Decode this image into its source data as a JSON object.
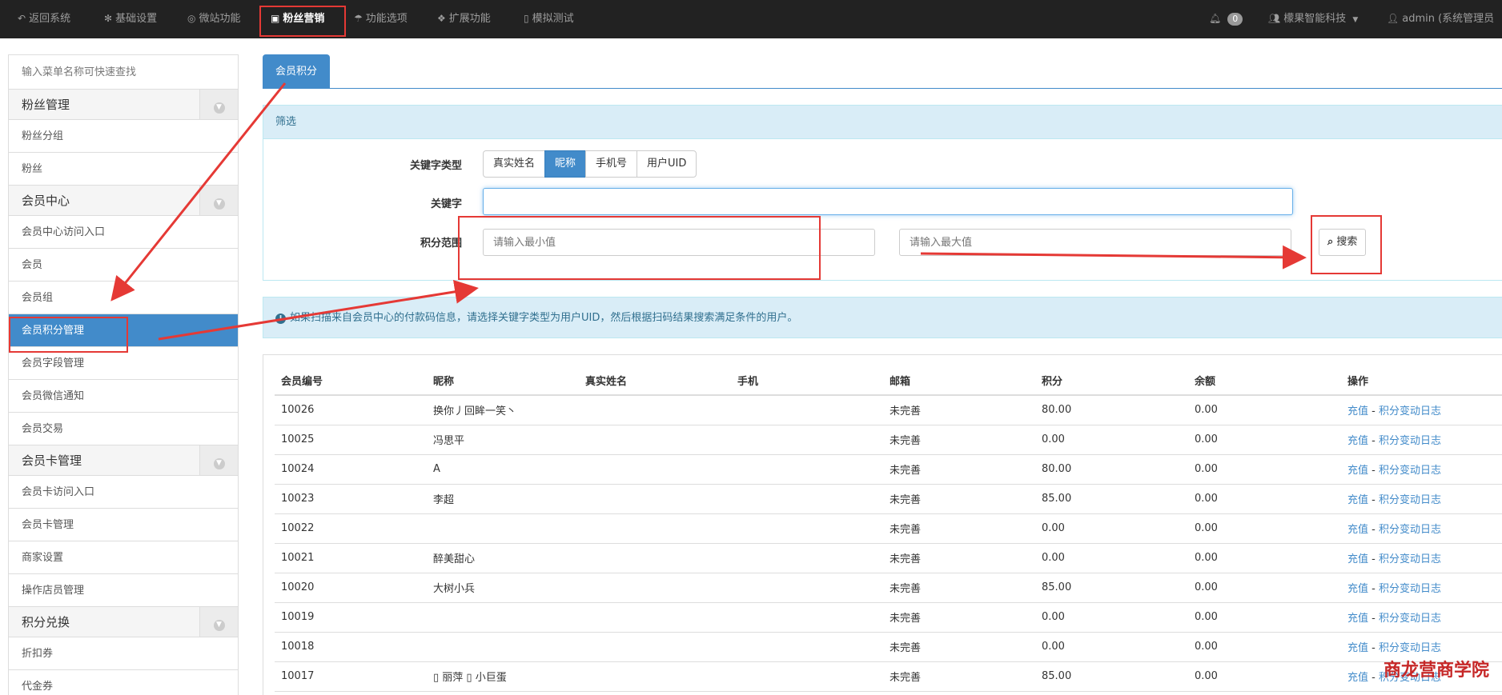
{
  "topnav": {
    "items": [
      {
        "icon": "undo-icon",
        "glyph": "↶",
        "label": "返回系统"
      },
      {
        "icon": "gear-icon",
        "glyph": "✻",
        "label": "基础设置"
      },
      {
        "icon": "globe-icon",
        "glyph": "◎",
        "label": "微站功能"
      },
      {
        "icon": "gift-icon",
        "glyph": "▣",
        "label": "粉丝营销"
      },
      {
        "icon": "umbrella-icon",
        "glyph": "☂",
        "label": "功能选项"
      },
      {
        "icon": "cubes-icon",
        "glyph": "❖",
        "label": "扩展功能"
      },
      {
        "icon": "mobile-icon",
        "glyph": "▯",
        "label": "模拟测试"
      }
    ],
    "notifications": "0",
    "company": "檬果智能科技",
    "user": "admin (系统管理员"
  },
  "sidebar": {
    "search_placeholder": "输入菜单名称可快速查找",
    "sections": [
      {
        "title": "粉丝管理",
        "items": [
          "粉丝分组",
          "粉丝"
        ]
      },
      {
        "title": "会员中心",
        "items": [
          "会员中心访问入口",
          "会员",
          "会员组",
          "会员积分管理",
          "会员字段管理",
          "会员微信通知",
          "会员交易"
        ]
      },
      {
        "title": "会员卡管理",
        "items": [
          "会员卡访问入口",
          "会员卡管理",
          "商家设置",
          "操作店员管理"
        ]
      },
      {
        "title": "积分兑换",
        "items": [
          "折扣券",
          "代金券"
        ]
      }
    ]
  },
  "main": {
    "tab": "会员积分",
    "filter": {
      "title": "筛选",
      "keyword_type_label": "关键字类型",
      "keyword_types": [
        "真实姓名",
        "昵称",
        "手机号",
        "用户UID"
      ],
      "keyword_label": "关键字",
      "keyword_value": "",
      "range_label": "积分范围",
      "min_placeholder": "请输入最小值",
      "max_placeholder": "请输入最大值",
      "search_label": "搜索"
    },
    "info": "如果扫描来自会员中心的付款码信息，请选择关键字类型为用户UID，然后根据扫码结果搜索满足条件的用户。",
    "table": {
      "headers": [
        "会员编号",
        "昵称",
        "真实姓名",
        "手机",
        "邮箱",
        "积分",
        "余额",
        "操作"
      ],
      "recharge_label": "充值",
      "separator": " - ",
      "log_label": "积分变动日志",
      "rows": [
        {
          "id": "10026",
          "nickname": "换你丿回眸一笑丶",
          "realname": "",
          "phone": "",
          "email": "未完善",
          "points": "80.00",
          "balance": "0.00"
        },
        {
          "id": "10025",
          "nickname": "冯思平",
          "realname": "",
          "phone": "",
          "email": "未完善",
          "points": "0.00",
          "balance": "0.00"
        },
        {
          "id": "10024",
          "nickname": "A",
          "realname": "",
          "phone": "",
          "email": "未完善",
          "points": "80.00",
          "balance": "0.00"
        },
        {
          "id": "10023",
          "nickname": "李超",
          "realname": "",
          "phone": "",
          "email": "未完善",
          "points": "85.00",
          "balance": "0.00"
        },
        {
          "id": "10022",
          "nickname": "",
          "realname": "",
          "phone": "",
          "email": "未完善",
          "points": "0.00",
          "balance": "0.00"
        },
        {
          "id": "10021",
          "nickname": "醉美甜心",
          "realname": "",
          "phone": "",
          "email": "未完善",
          "points": "0.00",
          "balance": "0.00"
        },
        {
          "id": "10020",
          "nickname": "大树小兵",
          "realname": "",
          "phone": "",
          "email": "未完善",
          "points": "85.00",
          "balance": "0.00"
        },
        {
          "id": "10019",
          "nickname": "",
          "realname": "",
          "phone": "",
          "email": "未完善",
          "points": "0.00",
          "balance": "0.00"
        },
        {
          "id": "10018",
          "nickname": "",
          "realname": "",
          "phone": "",
          "email": "未完善",
          "points": "0.00",
          "balance": "0.00"
        },
        {
          "id": "10017",
          "nickname": "▯ 丽萍 ▯ 小巨蛋",
          "realname": "",
          "phone": "",
          "email": "未完善",
          "points": "85.00",
          "balance": "0.00"
        }
      ]
    }
  },
  "watermark": "商龙营商学院",
  "colors": {
    "primary": "#428bca",
    "annotation": "#e53935",
    "navbar": "#222222",
    "info_bg": "#d9edf7"
  }
}
